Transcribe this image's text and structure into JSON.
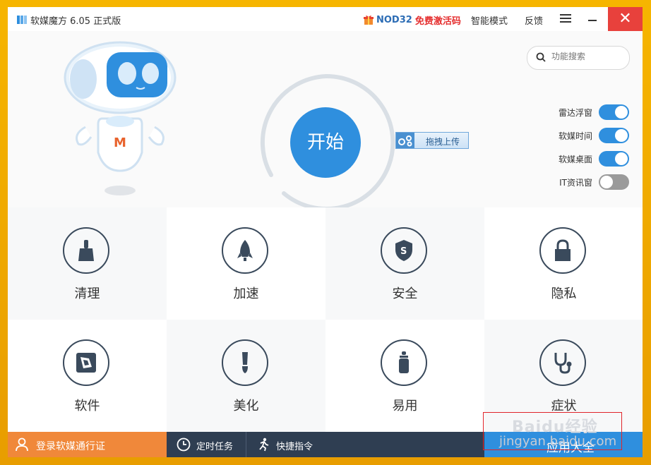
{
  "app": {
    "title": "软媒魔方 6.05 正式版"
  },
  "titlebar": {
    "promo_name": "NOD32",
    "promo_text": "免费激活码",
    "smart_mode": "智能模式",
    "feedback": "反馈",
    "close_glyph": "✕"
  },
  "hero": {
    "start_label": "开始",
    "upload_label": "拖拽上传",
    "search": {
      "placeholder": "功能搜索"
    },
    "toggles": [
      {
        "label": "雷达浮窗",
        "on": true
      },
      {
        "label": "软媒时间",
        "on": true
      },
      {
        "label": "软媒桌面",
        "on": true
      },
      {
        "label": "IT资讯窗",
        "on": false
      }
    ]
  },
  "tiles": [
    {
      "label": "清理",
      "icon": "broom-icon"
    },
    {
      "label": "加速",
      "icon": "rocket-icon"
    },
    {
      "label": "安全",
      "icon": "shield-icon"
    },
    {
      "label": "隐私",
      "icon": "lock-icon"
    },
    {
      "label": "软件",
      "icon": "aperture-icon"
    },
    {
      "label": "美化",
      "icon": "brush-icon"
    },
    {
      "label": "易用",
      "icon": "bottle-icon"
    },
    {
      "label": "症状",
      "icon": "stethoscope-icon"
    }
  ],
  "bottombar": {
    "login": "登录软媒通行证",
    "scheduled_tasks": "定时任务",
    "quick_commands": "快捷指令",
    "apps": "应用大全"
  },
  "watermark": {
    "brand": "Baidu经验",
    "url": "jingyan.baidu.com"
  },
  "colors": {
    "accent": "#2f8fde",
    "login_bar": "#f0883a",
    "bottom_bar": "#2f3e52",
    "close": "#e8413c",
    "frame": "#f2a900"
  }
}
